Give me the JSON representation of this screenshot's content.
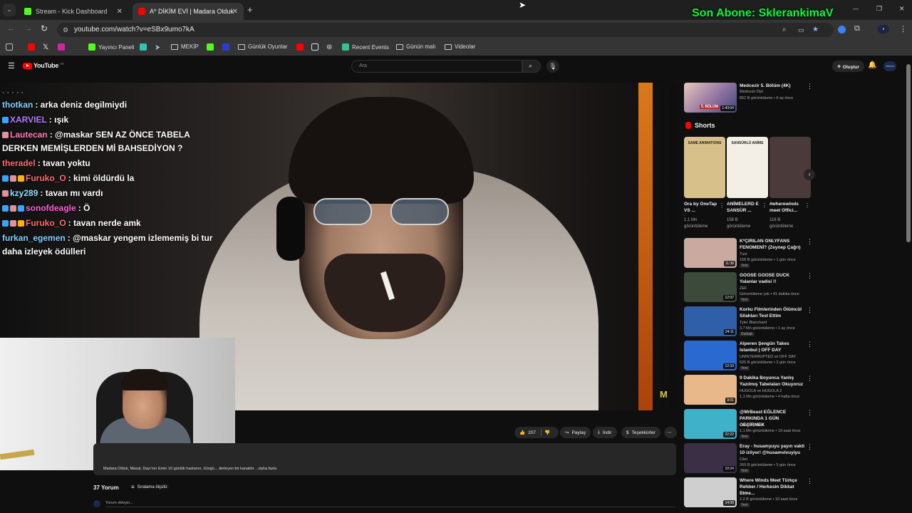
{
  "browser": {
    "tabs": [
      {
        "label": "Stream - Kick Dashboard",
        "active": false
      },
      {
        "label": "A* DİKİM EVİ | Madara Olduk #",
        "active": true
      }
    ],
    "new_tab": "+",
    "url": "youtube.com/watch?v=eSBx9umo7kA",
    "window_controls": {
      "minimize": "—",
      "maximize": "❐",
      "close": "✕"
    }
  },
  "overlay": {
    "last_subscriber": "Son Abone: SklerankimaV",
    "watermark": "M"
  },
  "bookmarks": [
    {
      "label": "Yayıncı Paneli",
      "icon": "kick-icon"
    },
    {
      "label": "MEKİP",
      "icon": "folder-icon"
    },
    {
      "label": "Günlük Oyunlar",
      "icon": "folder-icon"
    },
    {
      "label": "Recent Events",
      "icon": "events-icon"
    },
    {
      "label": "Günün malı",
      "icon": "folder-icon"
    },
    {
      "label": "Videolar",
      "icon": "folder-icon"
    }
  ],
  "youtube": {
    "logo_text": "YouTube",
    "logo_sup": "TR",
    "search_placeholder": "Ara",
    "create_label": "Oluştur",
    "avatar_text": "Ahmet"
  },
  "chat": [
    {
      "user": "thotkan",
      "color": "#7fd0ff",
      "message": ": arka deniz degilmiydi",
      "badges": []
    },
    {
      "user": "XARVIEL",
      "color": "#b57bff",
      "message": ": ışık",
      "badges": [
        "#3aa3ff"
      ]
    },
    {
      "user": "Lautecan",
      "color": "#ff7fb5",
      "message": ": @maskar SEN AZ ÖNCE TABELA",
      "message2": "DERKEN MEMİŞLERDEN Mİ BAHSEDİYON ?",
      "badges": [
        "#e38fa0"
      ]
    },
    {
      "user": "theradel",
      "color": "#ff6a6a",
      "message": ": tavan yoktu",
      "badges": []
    },
    {
      "user": "Furuko_O",
      "color": "#ff6a6a",
      "message": ": kimi öldürdü la",
      "badges": [
        "#3aa3ff",
        "#e38fa0",
        "#ffb300"
      ]
    },
    {
      "user": "kzy289",
      "color": "#8fe0ff",
      "message": ": tavan mı vardı",
      "badges": [
        "#e38fa0"
      ]
    },
    {
      "user": "sonofdeagle",
      "color": "#ff5fd4",
      "message": ": Ö",
      "badges": [
        "#3aa3ff",
        "#e38fa0",
        "#3aa3ff"
      ]
    },
    {
      "user": "Furuko_O",
      "color": "#ff6a6a",
      "message": ": tavan nerde amk",
      "badges": [
        "#3aa3ff",
        "#e38fa0",
        "#ffb300"
      ]
    },
    {
      "user": "furkan_egemen",
      "color": "#7fd0ff",
      "message": ": @maskar yengem izlememiş bi tur",
      "message2": "daha izleyek ödülleri",
      "badges": []
    }
  ],
  "actions": {
    "likes": "207",
    "share": "Paylaş",
    "download": "İndir",
    "thanks": "Teşekkürler",
    "more": "⋯"
  },
  "description": {
    "snippet": "Madara Olduk, Masal, Dayı'nın Emin 10 günlük hastanın, Görgü... derleyen bir kanaldır ...daha fazla"
  },
  "comments": {
    "count": "37 Yorum",
    "sort_label": "Sıralama ölçütü:",
    "add_placeholder": "Yorum ekleyin..."
  },
  "sidebar": {
    "top_rec": {
      "title": "Medcezir 5. Bölüm (4K)",
      "channel": "Medcezir Dizi",
      "meta": "852 B görüntüleme • 6 ay önce",
      "duration": "1:43:04",
      "thumb_label": "5. BÖLÜM"
    },
    "shorts_title": "Shorts",
    "shorts": [
      {
        "title": "Ora by OneTap VS ...",
        "views": "1,1 Mn görüntüleme",
        "thumb": "#d8c08a",
        "thumb_label": "SAME ANIMATIONS"
      },
      {
        "title": "ANİMELERD E SANSÜR ...",
        "views": "158 B görüntüleme",
        "thumb": "#f3eee6",
        "thumb_label": "SANSÜRLÜ ANİME"
      },
      {
        "title": "#wherewinds meet Offici...",
        "views": "116 B görüntüleme",
        "thumb": "#4a3a3a",
        "thumb_label": ""
      }
    ],
    "recs": [
      {
        "title": "K*ÇIRILAN ONLYFANS FENOMENİ? (Zeynep Çağrı)",
        "channel": "Tuni",
        "meta": "158 B görüntüleme • 1 gün önce",
        "new": "Yeni",
        "duration": "11:38",
        "thumb": "#c9a9a0"
      },
      {
        "title": "GOOSE GOOSE DUCK Yalanlar vadisi !!",
        "channel": "ZEF",
        "meta": "Görüntüleme yok • 41 dakika önce",
        "new": "Yeni",
        "duration": "12:07",
        "thumb": "#3b4a3a"
      },
      {
        "title": "Korku Filmlerinden Ölümcül Silahları Test Ettim",
        "channel": "Tyler Blanchard",
        "meta": "3,7 Mn görüntüleme • 1 ay önce",
        "new": "Dublajlı",
        "duration": "24:11",
        "thumb": "#2f5fa8"
      },
      {
        "title": "Alperen Şengün Takes Istanbul | OFF DAY",
        "channel": "UNINTERRUPTED ve OFF DAY",
        "meta": "525 B görüntüleme • 2 gün önce",
        "new": "Yeni",
        "duration": "12:33",
        "thumb": "#2a6ad0"
      },
      {
        "title": "9 Dakika Boyunca Yanlış Yazılmış Tabelaları Okuyoruz",
        "channel": "HUGOLA ve HUGOLA 2",
        "meta": "1,1 Mn görüntüleme • 4 hafta önce",
        "new": "",
        "duration": "9:01",
        "thumb": "#e8b88a"
      },
      {
        "title": "@MrBeast EĞLENCE PARKINDA 1 GÜN GEÇİRMEK",
        "channel": "Orkun Işıtmak",
        "meta": "1,1 Mn görüntüleme • 19 saat önce",
        "new": "Yeni",
        "duration": "22:22",
        "thumb": "#3fb1c9"
      },
      {
        "title": "Eray - husamyuyu yayın vakti 10 izliyor! @husamvivuyiyu",
        "channel": "Cilet",
        "meta": "269 B görüntüleme • 5 gün önce",
        "new": "Yeni",
        "duration": "10:24",
        "thumb": "#3a2f45"
      },
      {
        "title": "Where Winds Meet Türkçe Rehber / Herkesin Dikkat Etme...",
        "channel": "Poly",
        "meta": "2,2 B görüntüleme • 10 saat önce",
        "new": "Yeni",
        "duration": "14:08",
        "thumb": "#cfcfcf"
      }
    ]
  },
  "colors": {
    "accent_red": "#ff0000",
    "overlay_green": "#00ff3c",
    "chrome_bg": "#353535"
  }
}
